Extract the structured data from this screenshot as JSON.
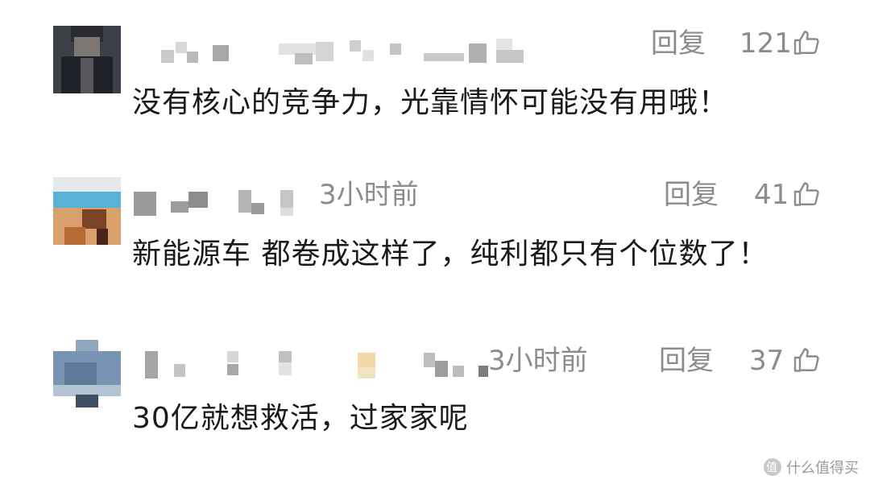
{
  "ui": {
    "reply_label": "回复"
  },
  "comments": [
    {
      "time": "",
      "likes": "121",
      "text": "没有核心的竞争力，光靠情怀可能没有用哦！"
    },
    {
      "time": "3小时前",
      "likes": "41",
      "text": "新能源车 都卷成这样了，纯利都只有个位数了！"
    },
    {
      "time": "3小时前",
      "likes": "37",
      "text": "30亿就想救活，过家家呢"
    }
  ],
  "watermark": {
    "text": "什么值得买",
    "icon": "smzdm-logo-icon"
  }
}
